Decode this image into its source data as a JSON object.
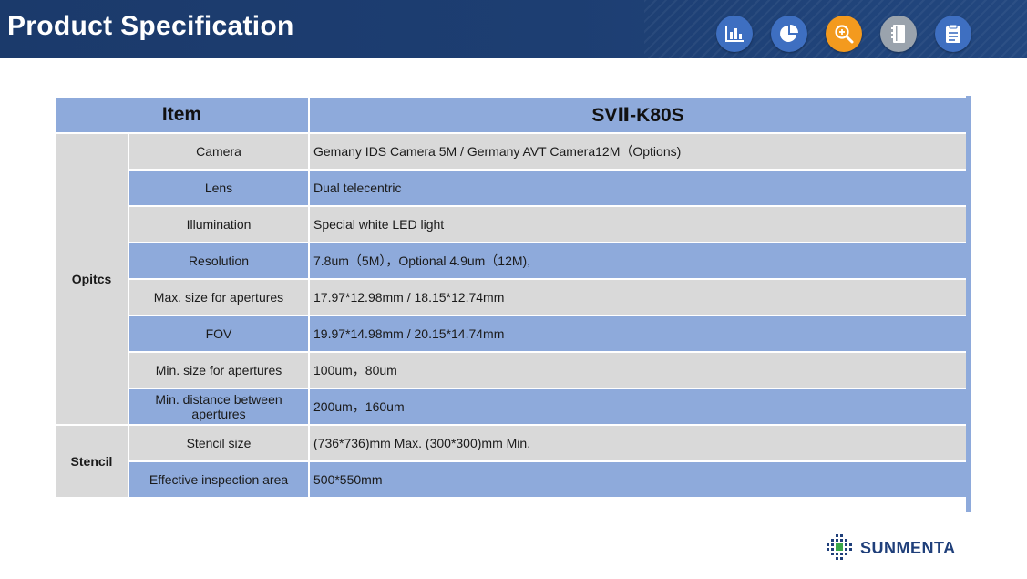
{
  "header": {
    "title": "Product Specification",
    "icons": [
      "bar-chart-icon",
      "pie-chart-icon",
      "magnifier-icon",
      "notebook-icon",
      "checklist-icon"
    ],
    "icon_colors": [
      "#3e6fc1",
      "#3e6fc1",
      "#f39a1e",
      "#9aa3ad",
      "#3e6fc1"
    ]
  },
  "table": {
    "head_item": "Item",
    "head_model": "SVⅡ-K80S",
    "groups": [
      {
        "name": "Opitcs",
        "rows": [
          {
            "item": "Camera",
            "value": "Gemany IDS Camera 5M / Germany AVT Camera12M（Options)"
          },
          {
            "item": "Lens",
            "value": "Dual telecentric"
          },
          {
            "item": "Illumination",
            "value": "Special white LED light"
          },
          {
            "item": "Resolution",
            "value": "7.8um（5M），Optional  4.9um（12M),"
          },
          {
            "item": "Max. size for apertures",
            "value": "17.97*12.98mm / 18.15*12.74mm"
          },
          {
            "item": "FOV",
            "value": "19.97*14.98mm / 20.15*14.74mm"
          },
          {
            "item": "Min. size for apertures",
            "value": "100um，80um"
          },
          {
            "item": "Min. distance between apertures",
            "value": "200um，160um"
          }
        ]
      },
      {
        "name": "Stencil",
        "rows": [
          {
            "item": "Stencil size",
            "value": "(736*736)mm Max. (300*300)mm Min."
          },
          {
            "item": "Effective inspection area",
            "value": "500*550mm"
          }
        ]
      }
    ]
  },
  "logo": {
    "text": "SUNMENTA"
  },
  "colors": {
    "header": "#1d3e72",
    "row_blue": "#8eaadb",
    "row_gray": "#d9d9d9"
  }
}
